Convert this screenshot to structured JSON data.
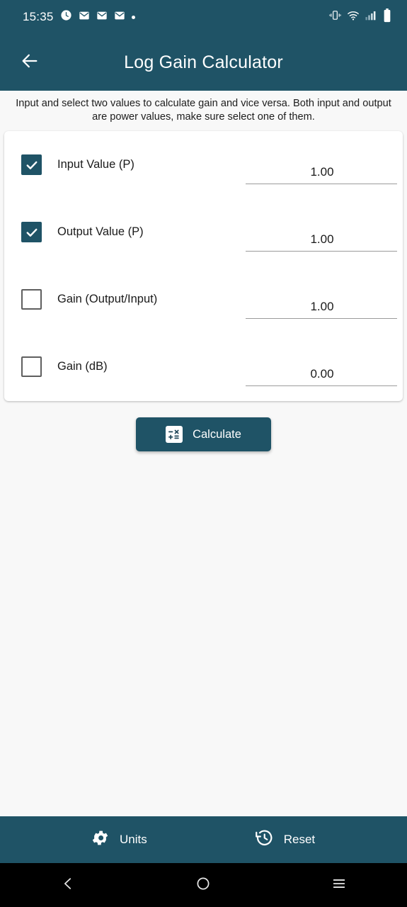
{
  "status_bar": {
    "time": "15:35",
    "left_icons": [
      "alarm-clock-icon",
      "mail-icon",
      "mail-icon",
      "mail-icon",
      "dot-indicator-icon"
    ],
    "right_icons": [
      "vibrate-icon",
      "wifi-icon",
      "cellular-signal-icon",
      "battery-icon"
    ]
  },
  "app_bar": {
    "back_icon": "arrow-left-icon",
    "title": "Log Gain Calculator"
  },
  "description": "Input and select two values to calculate gain and vice versa. Both input and output are power values, make sure select one of them.",
  "rows": [
    {
      "label": "Input Value (P)",
      "checked": true,
      "value": "1.00"
    },
    {
      "label": "Output Value (P)",
      "checked": true,
      "value": "1.00"
    },
    {
      "label": "Gain (Output/Input)",
      "checked": false,
      "value": "1.00"
    },
    {
      "label": "Gain (dB)",
      "checked": false,
      "value": "0.00"
    }
  ],
  "calculate_button": {
    "label": "Calculate",
    "icon": "calculator-icon"
  },
  "bottom_bar": {
    "units": {
      "label": "Units",
      "icon": "gear-icon"
    },
    "reset": {
      "label": "Reset",
      "icon": "history-restore-icon"
    }
  },
  "nav_bar": {
    "back": "chevron-left-icon",
    "home": "circle-icon",
    "recents": "menu-lines-icon"
  },
  "colors": {
    "primary": "#1f5366",
    "page_background": "#f8f8f8",
    "card_background": "#ffffff",
    "nav_background": "#000000",
    "text_primary": "#1a1a1a",
    "underline": "#9b9b9b"
  }
}
